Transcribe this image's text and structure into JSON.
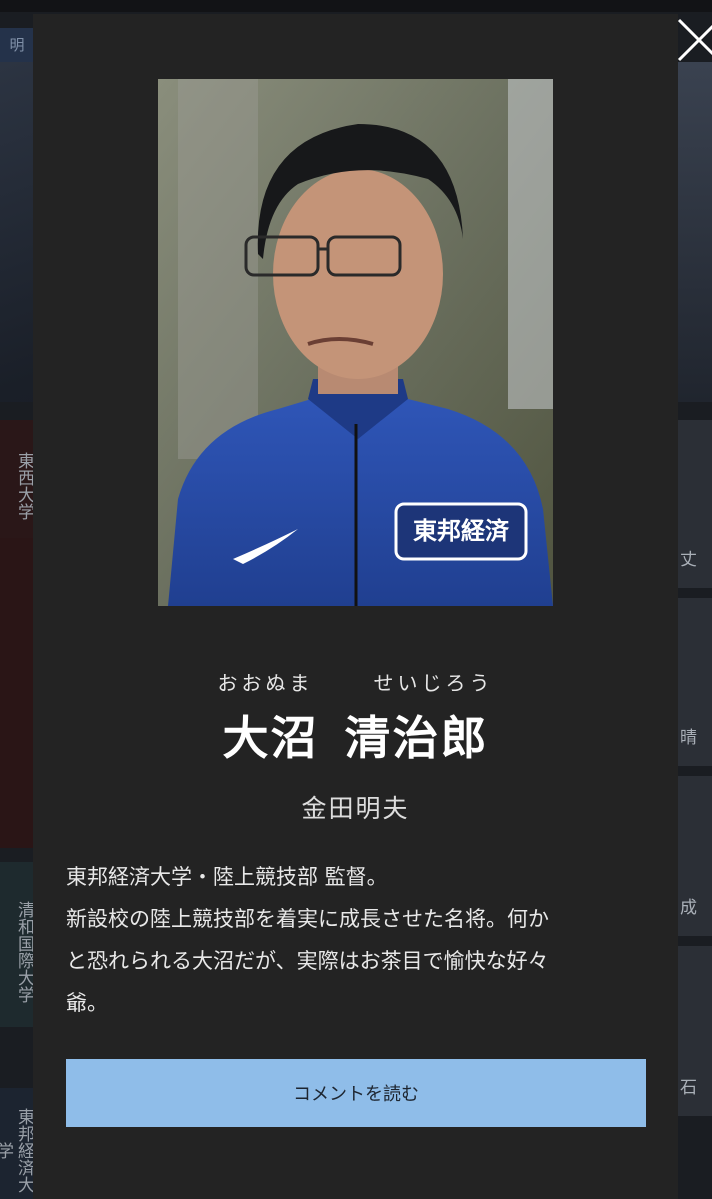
{
  "background": {
    "tab_label": "明",
    "universities": [
      {
        "label": "東西大学"
      },
      {
        "label": "清和国際大学"
      },
      {
        "label": "東邦経済大学"
      }
    ],
    "side_cards": [
      {
        "glyph": "丈"
      },
      {
        "glyph": "晴"
      },
      {
        "glyph": "成"
      },
      {
        "glyph": "石"
      }
    ]
  },
  "modal": {
    "close_icon": "close-icon",
    "photo": {
      "jacket_badge": "東邦経済",
      "accent_color": "#2a4fb0"
    },
    "ruby": {
      "family": "おおぬま",
      "given": "せいじろう"
    },
    "name": {
      "family": "大沼",
      "given": "清治郎"
    },
    "actor": "金田明夫",
    "description": [
      "東邦経済大学・陸上競技部 監督。",
      "新設校の陸上競技部を着実に成長させた名将。何か",
      "と恐れられる大沼だが、実際はお茶目で愉快な好々",
      "爺。"
    ],
    "cta_label": "コメントを読む",
    "cta_color": "#8fbde9"
  }
}
